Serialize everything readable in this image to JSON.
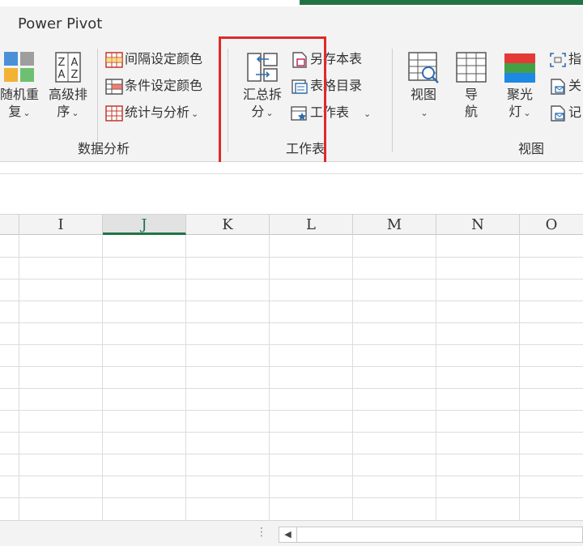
{
  "ribbon_tab": "Power Pivot",
  "data_analysis": {
    "random_repeat_line1": "随机重",
    "random_repeat_line2": "复",
    "advanced_sort_line1": "高级排",
    "advanced_sort_line2": "序",
    "interval_color": "间隔设定颜色",
    "conditional_color": "条件设定颜色",
    "stats_analysis": "统计与分析",
    "group_label": "数据分析"
  },
  "worksheet": {
    "merge_split_line1": "汇总拆",
    "merge_split_line2": "分",
    "save_table": "另存本表",
    "table_directory": "表格目录",
    "worksheet_menu": "工作表",
    "group_label": "工作表"
  },
  "view": {
    "view_label": "视图",
    "nav_line1": "导",
    "nav_line2": "航",
    "spotlight_line1": "聚光",
    "spotlight_line2": "灯",
    "fingerprint_partial": "指",
    "related_partial": "关",
    "record_partial": "记",
    "group_label": "视图"
  },
  "columns": [
    "I",
    "J",
    "K",
    "L",
    "M",
    "N",
    "O"
  ],
  "selected_column": "J",
  "colors": {
    "accent_green": "#217346",
    "highlight_red": "#e02a2a"
  }
}
